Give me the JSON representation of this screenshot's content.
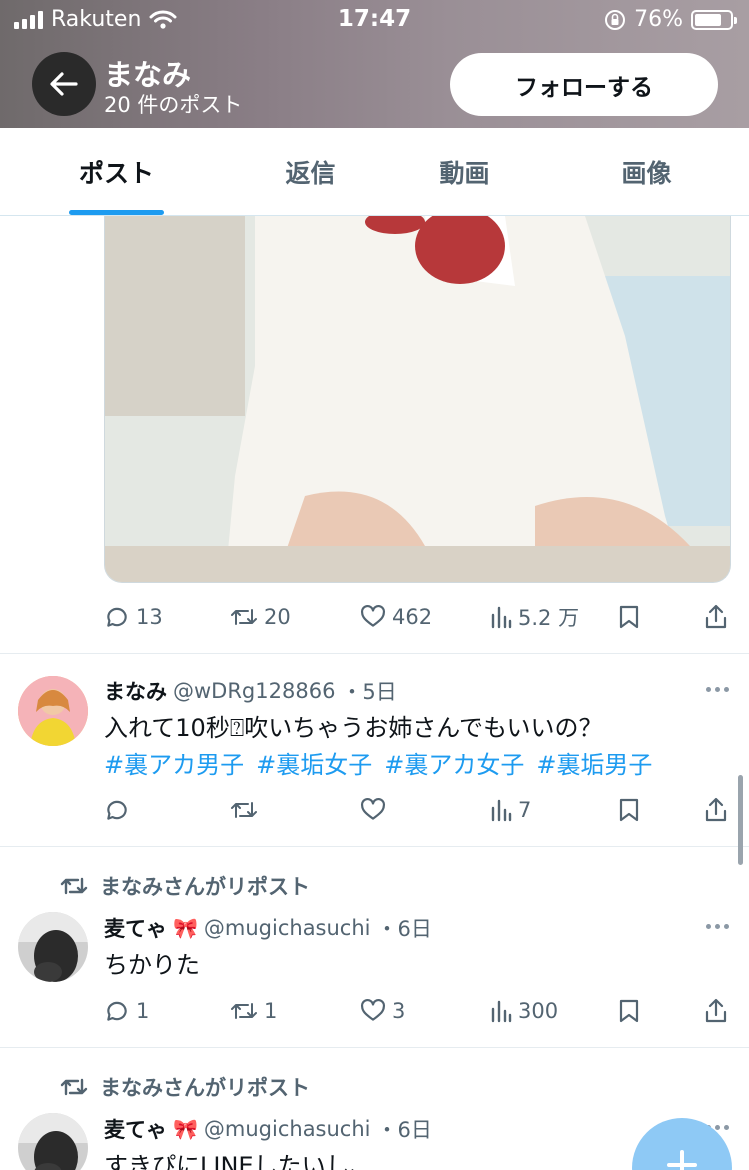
{
  "status_bar": {
    "carrier": "Rakuten",
    "time": "17:47",
    "battery": "76%",
    "battery_level": 0.76
  },
  "header": {
    "name": "まなみ",
    "post_count": "20 件のポスト",
    "follow_label": "フォローする"
  },
  "tabs": [
    {
      "label": "ポスト",
      "active": true
    },
    {
      "label": "返信",
      "active": false
    },
    {
      "label": "動画",
      "active": false
    },
    {
      "label": "画像",
      "active": false
    }
  ],
  "media_post": {
    "replies": "13",
    "reposts": "20",
    "likes": "462",
    "views": "5.2 万"
  },
  "posts": [
    {
      "name": "まなみ",
      "handle": "@wDRg128866",
      "time": "・5日",
      "text": "入れて10秒⍰吹いちゃうお姉さんでもいいの？",
      "hashtags": [
        "#裏アカ男子",
        "#裏垢女子",
        "#裏アカ女子",
        "#裏垢男子"
      ],
      "replies": "",
      "reposts": "",
      "likes": "",
      "views": "7"
    },
    {
      "repost_by": "まなみさんがリポスト",
      "name": "麦てゃ",
      "handle": "@mugichasuchi",
      "time": "・6日",
      "text": "ちかりた",
      "replies": "1",
      "reposts": "1",
      "likes": "3",
      "views": "300"
    },
    {
      "repost_by": "まなみさんがリポスト",
      "name": "麦てゃ",
      "handle": "@mugichasuchi",
      "time": "・6日",
      "text": "すきぴにLINEしたいし、"
    }
  ],
  "colors": {
    "accent": "#1d9bf0",
    "secondary_text": "#536471"
  }
}
